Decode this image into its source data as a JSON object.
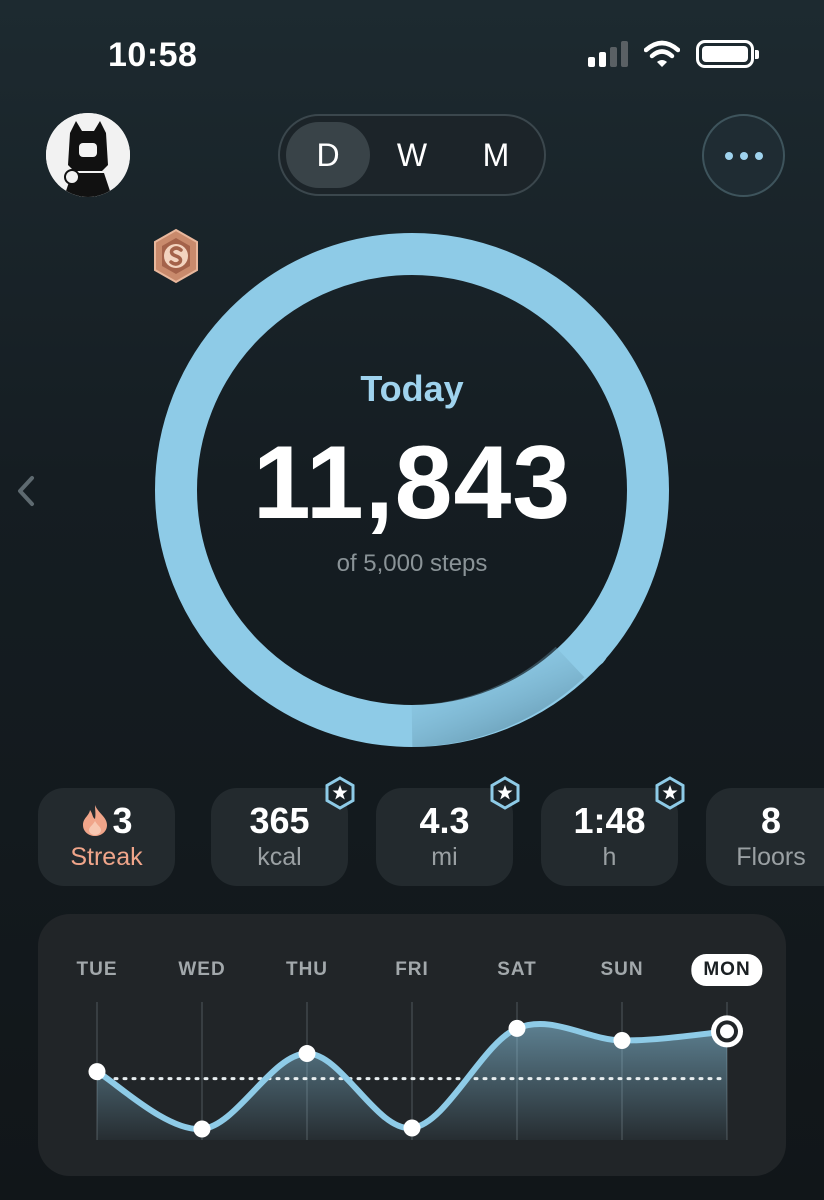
{
  "status_bar": {
    "time": "10:58"
  },
  "header": {
    "tabs": [
      {
        "label": "D",
        "active": true
      },
      {
        "label": "W",
        "active": false
      },
      {
        "label": "M",
        "active": false
      }
    ]
  },
  "progress": {
    "label": "Today",
    "steps": "11,843",
    "goal_text": "of 5,000 steps",
    "fraction": 1.0,
    "ring_color": "#8ecbe7"
  },
  "stats": [
    {
      "value": "3",
      "unit": "Streak",
      "icon": "flame-icon",
      "achievement": false
    },
    {
      "value": "365",
      "unit": "kcal",
      "achievement": true
    },
    {
      "value": "4.3",
      "unit": "mi",
      "achievement": true
    },
    {
      "value": "1:48",
      "unit": "h",
      "achievement": true
    },
    {
      "value": "8",
      "unit": "Floors",
      "achievement": false
    }
  ],
  "week": {
    "days": [
      "TUE",
      "WED",
      "THU",
      "FRI",
      "SAT",
      "SUN",
      "MON"
    ],
    "selected": "MON",
    "relative_values": [
      0.62,
      0.05,
      0.8,
      0.06,
      1.05,
      0.93,
      1.02
    ],
    "goal_level": 0.55,
    "line_color": "#8ecbe7"
  }
}
